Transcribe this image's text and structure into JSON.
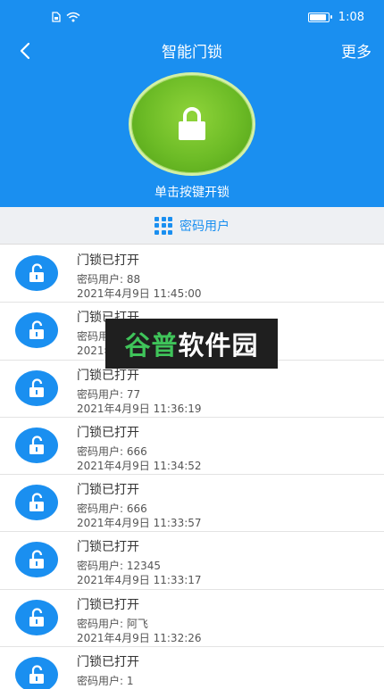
{
  "status_bar": {
    "time": "1:08",
    "battery_level": 0.85
  },
  "header": {
    "title": "智能门锁",
    "more_label": "更多",
    "tap_to_unlock_label": "单击按键开锁"
  },
  "user_bar": {
    "label": "密码用户"
  },
  "log": [
    {
      "title": "门锁已打开",
      "user": "密码用户: 88",
      "time": "2021年4月9日 11:45:00"
    },
    {
      "title": "门锁已打开",
      "user": "密码用户: 9",
      "time": "2021年4月9日 11:40:13"
    },
    {
      "title": "门锁已打开",
      "user": "密码用户: 77",
      "time": "2021年4月9日 11:36:19"
    },
    {
      "title": "门锁已打开",
      "user": "密码用户: 666",
      "time": "2021年4月9日 11:34:52"
    },
    {
      "title": "门锁已打开",
      "user": "密码用户: 666",
      "time": "2021年4月9日 11:33:57"
    },
    {
      "title": "门锁已打开",
      "user": "密码用户: 12345",
      "time": "2021年4月9日 11:33:17"
    },
    {
      "title": "门锁已打开",
      "user": "密码用户: 阿飞",
      "time": "2021年4月9日 11:32:26"
    },
    {
      "title": "门锁已打开",
      "user": "密码用户: 1",
      "time": ""
    }
  ],
  "watermark": {
    "part1": "谷普",
    "part2": "软件园"
  },
  "colors": {
    "primary": "#1a8ff0",
    "lock_green": "#6cbb26"
  }
}
